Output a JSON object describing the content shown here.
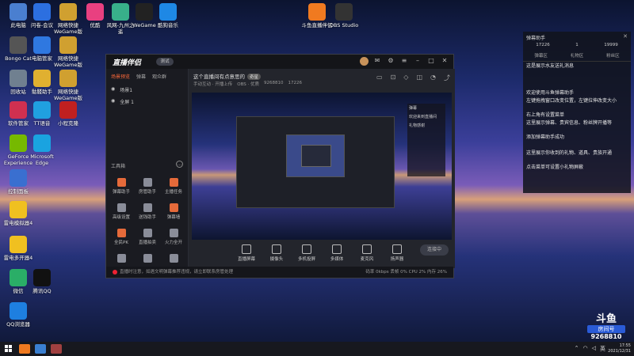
{
  "desktop": {
    "icons": [
      {
        "label": "此电脑",
        "color": "#4a7fd0"
      },
      {
        "label": "问卷-会议",
        "color": "#2c6fe0"
      },
      {
        "label": "网络快捷 WeGame版",
        "color": "#d0a030"
      },
      {
        "label": "优酷",
        "color": "#e94080"
      },
      {
        "label": "风网-九州之遥",
        "color": "#38b08a"
      },
      {
        "label": "WeGame",
        "color": "#222"
      },
      {
        "label": "酷狗音乐",
        "color": "#1e88e5"
      },
      {
        "label": "斗鱼直播伴侣",
        "color": "#f07a20"
      },
      {
        "label": "OBS Studio",
        "color": "#333"
      },
      {
        "label": "Bongo Cat",
        "color": "#555"
      },
      {
        "label": "电脑管家",
        "color": "#2f78e0"
      },
      {
        "label": "网络快捷 WeGame版",
        "color": "#d0a030"
      },
      {
        "label": "回收站",
        "color": "#708090"
      },
      {
        "label": "骷髅助手",
        "color": "#e0b030"
      },
      {
        "label": "网络快捷 WeGame版",
        "color": "#d0a030"
      },
      {
        "label": "软件管家",
        "color": "#d03050"
      },
      {
        "label": "TT语音",
        "color": "#20a0e0"
      },
      {
        "label": "小程克隆",
        "color": "#c02020"
      },
      {
        "label": "GeForce Experience",
        "color": "#76b900"
      },
      {
        "label": "Microsoft Edge",
        "color": "#1aa3e0"
      },
      {
        "label": "控制面板",
        "color": "#3a6fd0"
      },
      {
        "label": "雷电模拟器4",
        "color": "#f0c020"
      },
      {
        "label": "雷电多开器4",
        "color": "#f0c020"
      },
      {
        "label": "微信",
        "color": "#2aae67"
      },
      {
        "label": "腾讯QQ",
        "color": "#111"
      },
      {
        "label": "QQ浏览器",
        "color": "#1e7fe0"
      }
    ]
  },
  "app": {
    "logo": "直播伴侣",
    "version": "测试",
    "left_tabs": [
      "场景预览",
      "弹幕",
      "观众群"
    ],
    "scenes": [
      "场景1",
      "全屏 1"
    ],
    "tools_title": "工具箱",
    "tools_more": "…",
    "tools": [
      "弹幕助手",
      "房管助手",
      "主播任务",
      "高级设置",
      "送钱助手",
      "弹幕墙",
      "全民PK",
      "直播拍卖",
      "火力全开",
      "资源管理",
      "连麦助手",
      "连麦PK"
    ],
    "stage_title": "这个直播间有点意思的",
    "stage_badge": "奇星",
    "stage_meta": [
      "手动互动 · 开播上传",
      "OBS · 优质",
      "9268810",
      "17226"
    ],
    "preview_chat": [
      "弹幕",
      "欢迎来到直播间",
      "礼物感谢"
    ],
    "bottom_tools": [
      "直播屏幕",
      "摄像头",
      "多机投屏",
      "多媒体",
      "麦克风",
      "扬声器"
    ],
    "start_label": "连接中",
    "status_text": "直播时注意，如遇文明弹幕推荐违规，请立即联系房管处理",
    "status_stats": "码率 0kbps  丢帧 0%  CPU 2%  内存 26%"
  },
  "right_panel": {
    "title": "弹幕助手",
    "stats": [
      "17226",
      "1",
      "19999"
    ],
    "tabs": [
      "弹幕区",
      "礼物区",
      "粉丝区"
    ],
    "lines": [
      "这是展示水友送礼消息",
      "欢迎使用斗鱼弹幕助手",
      "左键拖拽窗口改变位置，左键拉伸改变大小",
      "右上角有设置菜单",
      "这里展示弹幕、贵宾信息、粉丝牌开播等",
      "添加弹幕助手成功",
      "这里展示你收到的礼物、道具、贵族开通",
      "点击菜单可设置小礼物屏蔽"
    ]
  },
  "watermark": {
    "logo": "斗鱼",
    "badge": "房间号",
    "number": "9268810"
  },
  "taskbar": {
    "time": "17:55",
    "date": "2021/12/31"
  }
}
